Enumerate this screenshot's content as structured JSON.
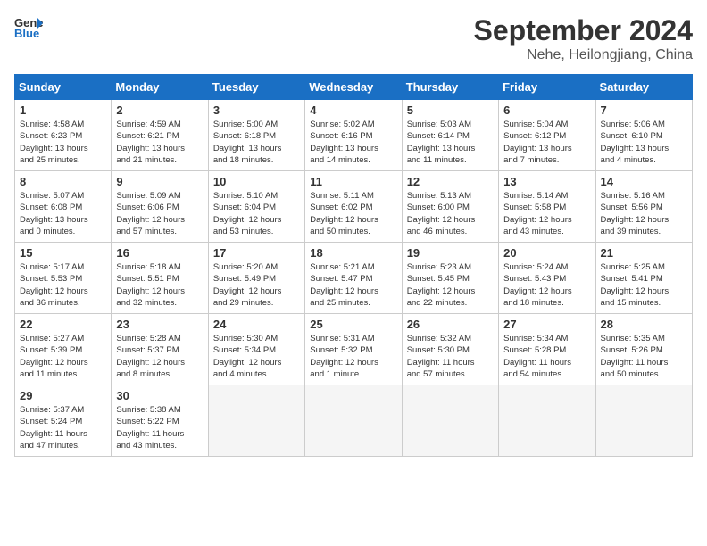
{
  "header": {
    "logo_line1": "General",
    "logo_line2": "Blue",
    "title": "September 2024",
    "subtitle": "Nehe, Heilongjiang, China"
  },
  "weekdays": [
    "Sunday",
    "Monday",
    "Tuesday",
    "Wednesday",
    "Thursday",
    "Friday",
    "Saturday"
  ],
  "days": [
    {
      "num": "",
      "info": ""
    },
    {
      "num": "",
      "info": ""
    },
    {
      "num": "",
      "info": ""
    },
    {
      "num": "",
      "info": ""
    },
    {
      "num": "",
      "info": ""
    },
    {
      "num": "",
      "info": ""
    },
    {
      "num": "",
      "info": ""
    },
    {
      "num": "1",
      "info": "Sunrise: 4:58 AM\nSunset: 6:23 PM\nDaylight: 13 hours\nand 25 minutes."
    },
    {
      "num": "2",
      "info": "Sunrise: 4:59 AM\nSunset: 6:21 PM\nDaylight: 13 hours\nand 21 minutes."
    },
    {
      "num": "3",
      "info": "Sunrise: 5:00 AM\nSunset: 6:18 PM\nDaylight: 13 hours\nand 18 minutes."
    },
    {
      "num": "4",
      "info": "Sunrise: 5:02 AM\nSunset: 6:16 PM\nDaylight: 13 hours\nand 14 minutes."
    },
    {
      "num": "5",
      "info": "Sunrise: 5:03 AM\nSunset: 6:14 PM\nDaylight: 13 hours\nand 11 minutes."
    },
    {
      "num": "6",
      "info": "Sunrise: 5:04 AM\nSunset: 6:12 PM\nDaylight: 13 hours\nand 7 minutes."
    },
    {
      "num": "7",
      "info": "Sunrise: 5:06 AM\nSunset: 6:10 PM\nDaylight: 13 hours\nand 4 minutes."
    },
    {
      "num": "8",
      "info": "Sunrise: 5:07 AM\nSunset: 6:08 PM\nDaylight: 13 hours\nand 0 minutes."
    },
    {
      "num": "9",
      "info": "Sunrise: 5:09 AM\nSunset: 6:06 PM\nDaylight: 12 hours\nand 57 minutes."
    },
    {
      "num": "10",
      "info": "Sunrise: 5:10 AM\nSunset: 6:04 PM\nDaylight: 12 hours\nand 53 minutes."
    },
    {
      "num": "11",
      "info": "Sunrise: 5:11 AM\nSunset: 6:02 PM\nDaylight: 12 hours\nand 50 minutes."
    },
    {
      "num": "12",
      "info": "Sunrise: 5:13 AM\nSunset: 6:00 PM\nDaylight: 12 hours\nand 46 minutes."
    },
    {
      "num": "13",
      "info": "Sunrise: 5:14 AM\nSunset: 5:58 PM\nDaylight: 12 hours\nand 43 minutes."
    },
    {
      "num": "14",
      "info": "Sunrise: 5:16 AM\nSunset: 5:56 PM\nDaylight: 12 hours\nand 39 minutes."
    },
    {
      "num": "15",
      "info": "Sunrise: 5:17 AM\nSunset: 5:53 PM\nDaylight: 12 hours\nand 36 minutes."
    },
    {
      "num": "16",
      "info": "Sunrise: 5:18 AM\nSunset: 5:51 PM\nDaylight: 12 hours\nand 32 minutes."
    },
    {
      "num": "17",
      "info": "Sunrise: 5:20 AM\nSunset: 5:49 PM\nDaylight: 12 hours\nand 29 minutes."
    },
    {
      "num": "18",
      "info": "Sunrise: 5:21 AM\nSunset: 5:47 PM\nDaylight: 12 hours\nand 25 minutes."
    },
    {
      "num": "19",
      "info": "Sunrise: 5:23 AM\nSunset: 5:45 PM\nDaylight: 12 hours\nand 22 minutes."
    },
    {
      "num": "20",
      "info": "Sunrise: 5:24 AM\nSunset: 5:43 PM\nDaylight: 12 hours\nand 18 minutes."
    },
    {
      "num": "21",
      "info": "Sunrise: 5:25 AM\nSunset: 5:41 PM\nDaylight: 12 hours\nand 15 minutes."
    },
    {
      "num": "22",
      "info": "Sunrise: 5:27 AM\nSunset: 5:39 PM\nDaylight: 12 hours\nand 11 minutes."
    },
    {
      "num": "23",
      "info": "Sunrise: 5:28 AM\nSunset: 5:37 PM\nDaylight: 12 hours\nand 8 minutes."
    },
    {
      "num": "24",
      "info": "Sunrise: 5:30 AM\nSunset: 5:34 PM\nDaylight: 12 hours\nand 4 minutes."
    },
    {
      "num": "25",
      "info": "Sunrise: 5:31 AM\nSunset: 5:32 PM\nDaylight: 12 hours\nand 1 minute."
    },
    {
      "num": "26",
      "info": "Sunrise: 5:32 AM\nSunset: 5:30 PM\nDaylight: 11 hours\nand 57 minutes."
    },
    {
      "num": "27",
      "info": "Sunrise: 5:34 AM\nSunset: 5:28 PM\nDaylight: 11 hours\nand 54 minutes."
    },
    {
      "num": "28",
      "info": "Sunrise: 5:35 AM\nSunset: 5:26 PM\nDaylight: 11 hours\nand 50 minutes."
    },
    {
      "num": "29",
      "info": "Sunrise: 5:37 AM\nSunset: 5:24 PM\nDaylight: 11 hours\nand 47 minutes."
    },
    {
      "num": "30",
      "info": "Sunrise: 5:38 AM\nSunset: 5:22 PM\nDaylight: 11 hours\nand 43 minutes."
    },
    {
      "num": "",
      "info": ""
    },
    {
      "num": "",
      "info": ""
    },
    {
      "num": "",
      "info": ""
    },
    {
      "num": "",
      "info": ""
    },
    {
      "num": "",
      "info": ""
    }
  ]
}
